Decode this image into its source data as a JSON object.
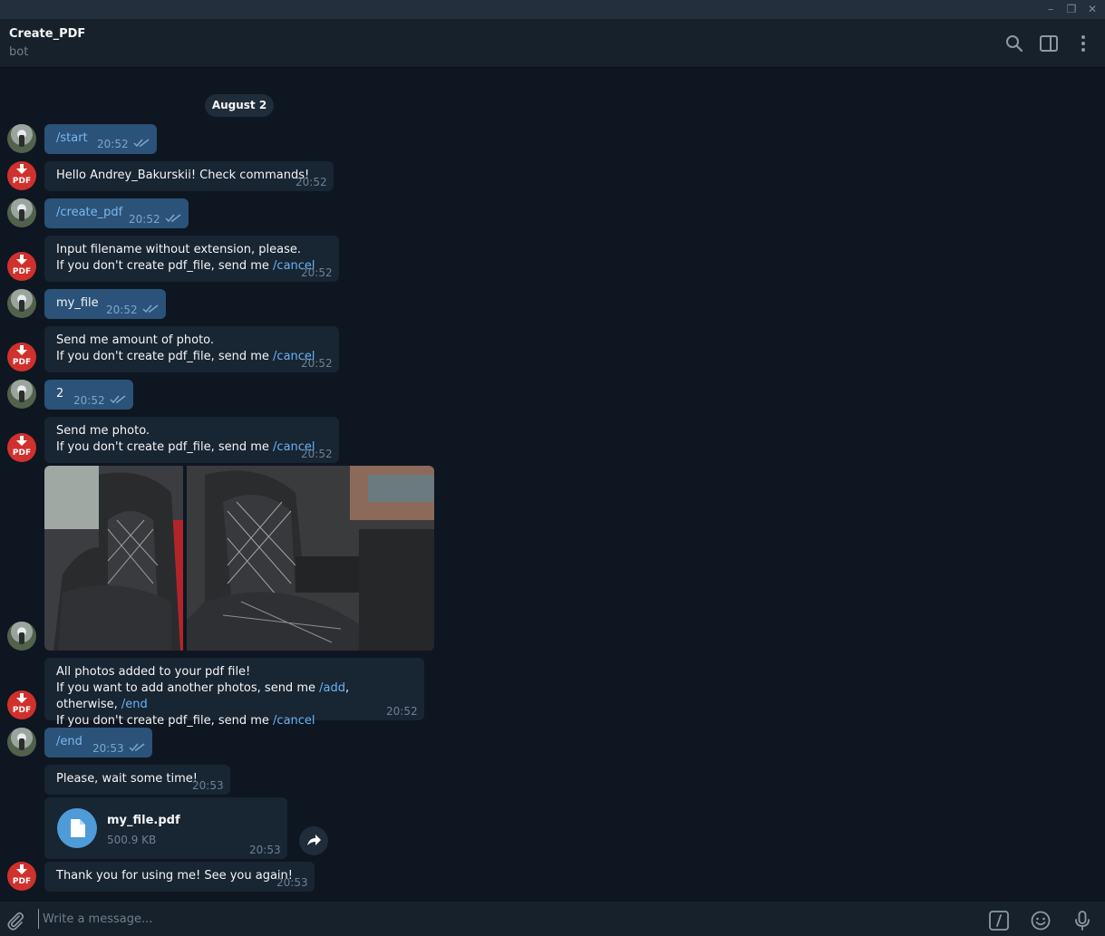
{
  "window": {
    "minimize_glyph": "–",
    "restore_glyph": "❐",
    "close_glyph": "✕"
  },
  "header": {
    "title": "Create_PDF",
    "subtitle": "bot",
    "icons": [
      "search-icon",
      "sidebar-toggle-icon",
      "more-vertical-icon"
    ]
  },
  "date_divider": "August 2",
  "bot_avatar_label": "PDF",
  "messages": [
    {
      "from": "user",
      "text": "/start",
      "time": "20:52"
    },
    {
      "from": "bot",
      "text": "Hello Andrey_Bakurskii! Check commands!",
      "time": "20:52"
    },
    {
      "from": "user",
      "text": "/create_pdf",
      "time": "20:52"
    },
    {
      "from": "bot",
      "line1": "Input filename without extension, please.",
      "line2_prefix": "If you don't create pdf_file, send me ",
      "cmd": "/cancel",
      "time": "20:52"
    },
    {
      "from": "user",
      "text": "my_file",
      "time": "20:52"
    },
    {
      "from": "bot",
      "line1": "Send me amount of photo.",
      "line2_prefix": "If you don't create pdf_file, send me ",
      "cmd": "/cancel",
      "time": "20:52"
    },
    {
      "from": "user",
      "text": "2",
      "time": "20:52"
    },
    {
      "from": "bot",
      "line1": "Send me photo.",
      "line2_prefix": "If you don't create pdf_file, send me ",
      "cmd": "/cancel",
      "time": "20:52"
    },
    {
      "from": "bot",
      "line1": "All photos added to your pdf file!",
      "line2_prefix": "If you want to add another photos, send me ",
      "cmd_add": "/add",
      "line2_mid": ", otherwise, ",
      "cmd_end": "/end",
      "line3_prefix": "If you don't create pdf_file, send me ",
      "cmd": "/cancel",
      "time": "20:52"
    },
    {
      "from": "user",
      "text": "/end",
      "time": "20:53"
    },
    {
      "from": "bot",
      "text": "Please, wait some time!",
      "time": "20:53"
    },
    {
      "from": "bot",
      "file_name": "my_file.pdf",
      "file_size": "500.9 KB",
      "time": "20:53"
    },
    {
      "from": "bot",
      "text": "Thank you for using me! See you again!",
      "time": "20:53"
    }
  ],
  "composer": {
    "placeholder": "Write a message...",
    "icons": [
      "attach-icon",
      "bot-commands-icon",
      "emoji-icon",
      "microphone-icon"
    ]
  },
  "colors": {
    "background": "#0e1621",
    "outgoing": "#2b5278",
    "incoming": "#182533",
    "link": "#6ab3f3",
    "bot_avatar": "#d0312d"
  }
}
